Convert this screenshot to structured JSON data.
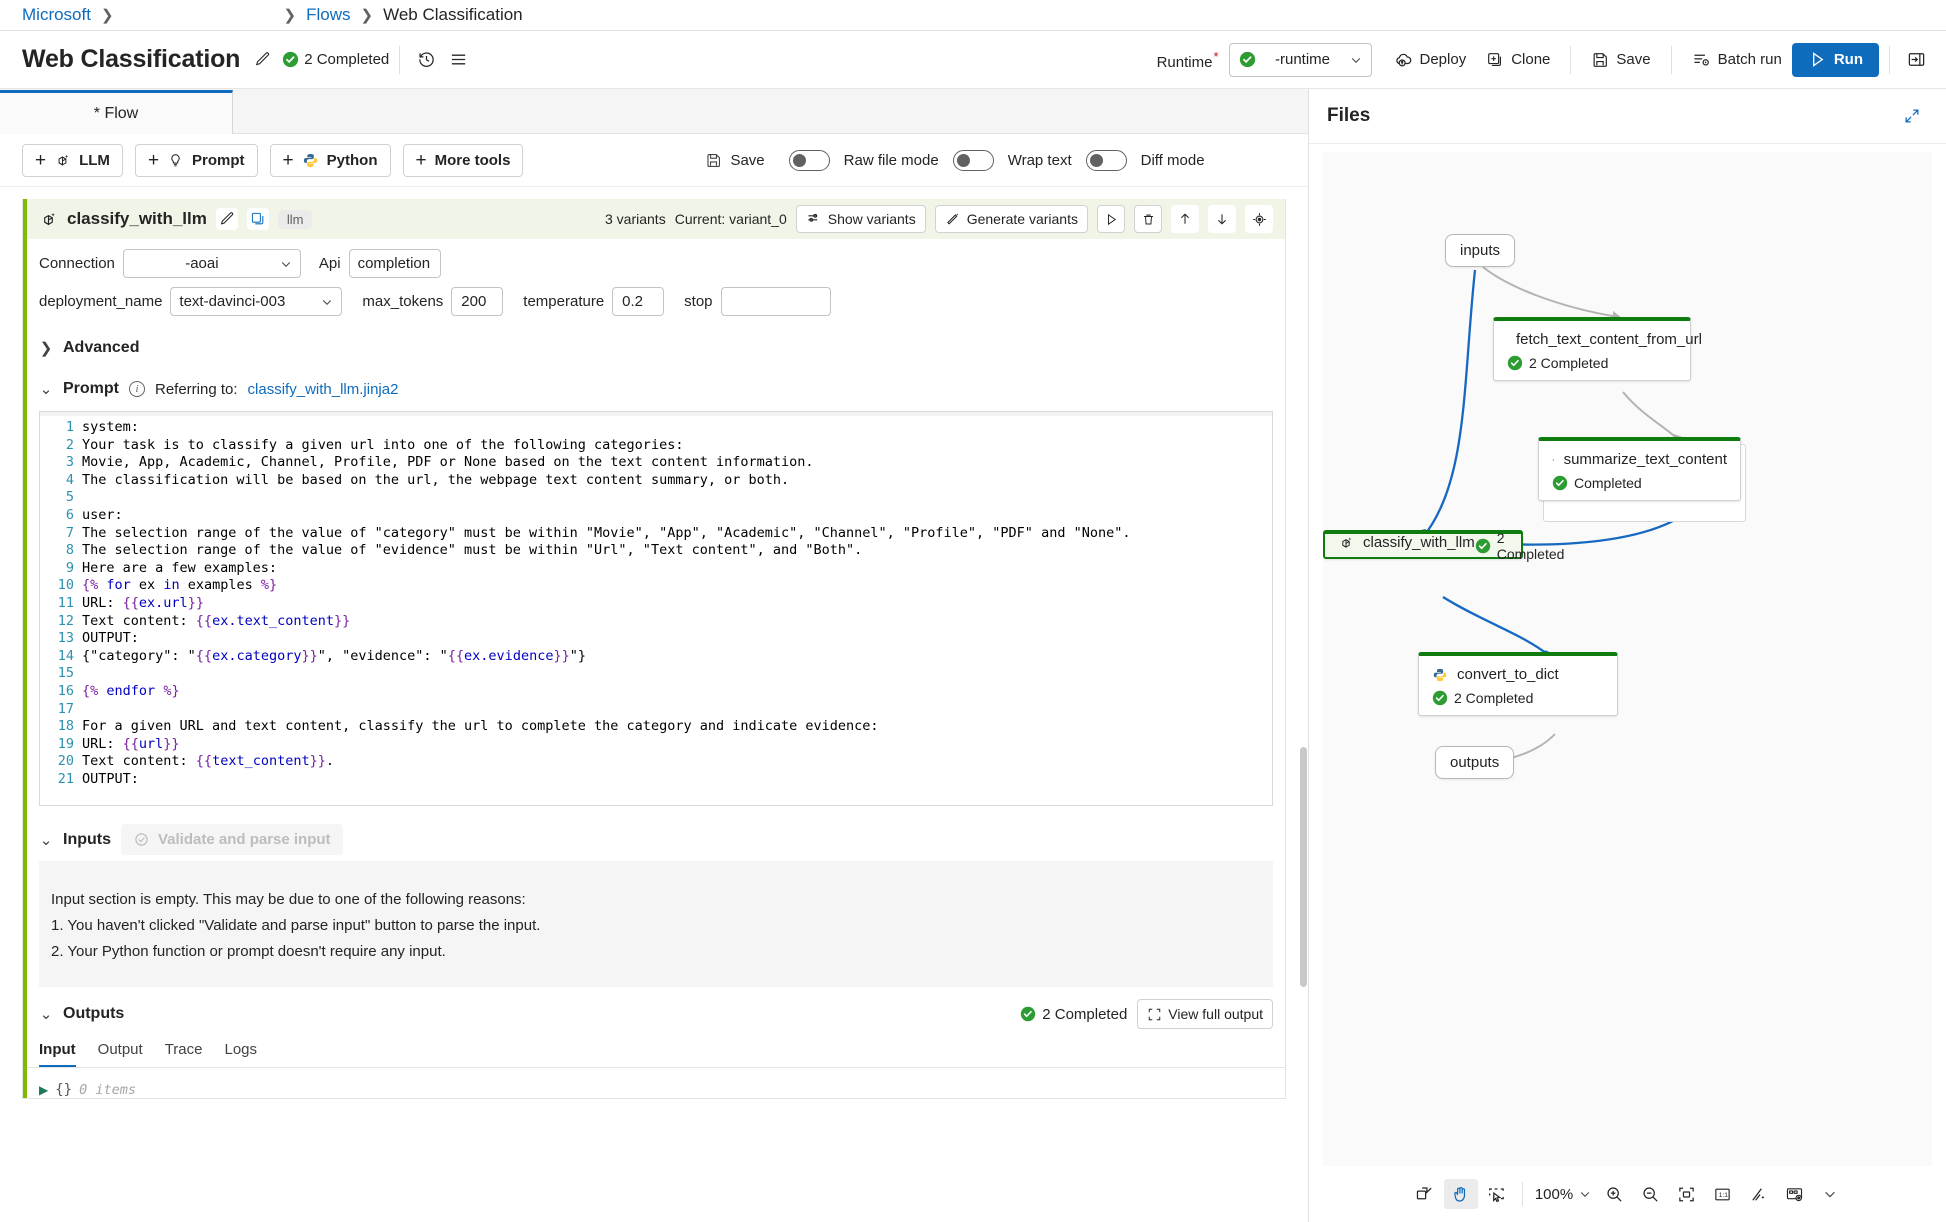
{
  "breadcrumb": {
    "items": [
      {
        "label": "Microsoft",
        "link": true
      },
      {
        "label": "Flows",
        "link": true
      },
      {
        "label": "Web Classification",
        "link": false
      }
    ]
  },
  "header": {
    "title": "Web Classification",
    "edit_icon": "pencil-icon",
    "status": "2 Completed",
    "history_icon": "history-icon",
    "list_icon": "list-icon",
    "runtime_label": "Runtime",
    "runtime_required_mark": "*",
    "runtime_value": "-runtime",
    "buttons": [
      {
        "label": "Deploy",
        "icon": "cloud-upload-icon"
      },
      {
        "label": "Clone",
        "icon": "copy-plus-icon"
      },
      {
        "label": "Save",
        "icon": "save-icon"
      },
      {
        "label": "Batch run",
        "icon": "batch-run-icon"
      },
      {
        "label": "Run",
        "icon": "play-icon",
        "primary": true
      }
    ],
    "panel_toggle_icon": "panel-right-icon"
  },
  "tabs": {
    "items": [
      {
        "label": "* Flow",
        "active": true
      }
    ]
  },
  "node_toolbar": {
    "add_buttons": [
      {
        "label": "LLM",
        "icon": "llm-icon"
      },
      {
        "label": "Prompt",
        "icon": "prompt-bulb-icon"
      },
      {
        "label": "Python",
        "icon": "python-icon"
      },
      {
        "label": "More tools",
        "icon": "none"
      }
    ],
    "save_label": "Save",
    "toggles": [
      {
        "label": "Raw file mode",
        "on": false
      },
      {
        "label": "Wrap text",
        "on": false
      },
      {
        "label": "Diff mode",
        "on": false
      }
    ]
  },
  "node": {
    "icon": "llm-icon",
    "name": "classify_with_llm",
    "edit_icon": "pencil-icon",
    "copy_icon": "copy-icon",
    "type_tag": "llm",
    "variants_count": "3 variants",
    "variant_current": "Current: variant_0",
    "show_variants_label": "Show variants",
    "generate_variants_label": "Generate variants",
    "actions": [
      "run-icon",
      "delete-icon",
      "move-up-icon",
      "move-down-icon",
      "locate-icon"
    ],
    "fields": {
      "connection_label": "Connection",
      "connection_value": "-aoai",
      "api_label": "Api",
      "api_value": "completion",
      "deployment_label": "deployment_name",
      "deployment_value": "text-davinci-003",
      "max_tokens_label": "max_tokens",
      "max_tokens_value": "200",
      "temperature_label": "temperature",
      "temperature_value": "0.2",
      "stop_label": "stop",
      "stop_value": ""
    },
    "advanced_label": "Advanced",
    "prompt_label": "Prompt",
    "prompt_referring_prefix": "Referring to:",
    "prompt_referring_file": "classify_with_llm.jinja2"
  },
  "code": {
    "line_numbers": [
      1,
      2,
      3,
      4,
      5,
      6,
      7,
      8,
      9,
      10,
      11,
      12,
      13,
      14,
      15,
      16,
      17,
      18,
      19,
      20,
      21
    ],
    "lines": [
      "system:",
      "Your task is to classify a given url into one of the following categories:",
      "Movie, App, Academic, Channel, Profile, PDF or None based on the text content information.",
      "The classification will be based on the url, the webpage text content summary, or both.",
      "",
      "user:",
      "The selection range of the value of \"category\" must be within \"Movie\", \"App\", \"Academic\", \"Channel\", \"Profile\", \"PDF\" and \"None\".",
      "The selection range of the value of \"evidence\" must be within \"Url\", \"Text content\", and \"Both\".",
      "Here are a few examples:",
      "{% for ex in examples %}",
      "URL: {{ex.url}}",
      "Text content: {{ex.text_content}}",
      "OUTPUT:",
      "{\"category\": \"{{ex.category}}\", \"evidence\": \"{{ex.evidence}}\"}",
      "",
      "{% endfor %}",
      "",
      "For a given URL and text content, classify the url to complete the category and indicate evidence:",
      "URL: {{url}}",
      "Text content: {{text_content}}.",
      "OUTPUT:"
    ]
  },
  "inputs_section": {
    "title": "Inputs",
    "validate_button": "Validate and parse input",
    "empty_lines": [
      "Input section is empty. This may be due to one of the following reasons:",
      "1. You haven't clicked \"Validate and parse input\" button to parse the input.",
      "2. Your Python function or prompt doesn't require any input."
    ]
  },
  "outputs_section": {
    "title": "Outputs",
    "status": "2 Completed",
    "view_full_output": "View full output",
    "tabs": [
      "Input",
      "Output",
      "Trace",
      "Logs"
    ],
    "active_tab": "Input",
    "json_brace": "{}",
    "json_items": "0 items"
  },
  "right_panel": {
    "title": "Files",
    "expand_icon": "expand-icon",
    "collapse_icon": "collapse-graph-icon"
  },
  "graph": {
    "nodes": [
      {
        "label": "inputs",
        "kind": "pill"
      },
      {
        "label": "fetch_text_content_from_url",
        "status": "2 Completed",
        "kind": "python"
      },
      {
        "label": "summarize_text_content",
        "status": "Completed",
        "kind": "llm"
      },
      {
        "label": "classify_with_llm",
        "status": "2 Completed",
        "kind": "llm",
        "selected": true
      },
      {
        "label": "convert_to_dict",
        "status": "2 Completed",
        "kind": "python"
      },
      {
        "label": "outputs",
        "kind": "pill"
      }
    ],
    "toolbar": {
      "zoom_value": "100%",
      "buttons": [
        "fit-view-icon",
        "pan-hand-icon",
        "select-region-icon",
        "zoom-in-icon",
        "zoom-out-icon",
        "fit-screen-icon",
        "actual-size-icon",
        "auto-layout-icon",
        "graph-settings-icon",
        "chevron-down-icon"
      ]
    }
  },
  "colors": {
    "accent": "#0f6cbd",
    "link": "#0f6cbd",
    "success": "#107c10",
    "node_bar": "#7fba00",
    "required": "#c50f1f"
  }
}
